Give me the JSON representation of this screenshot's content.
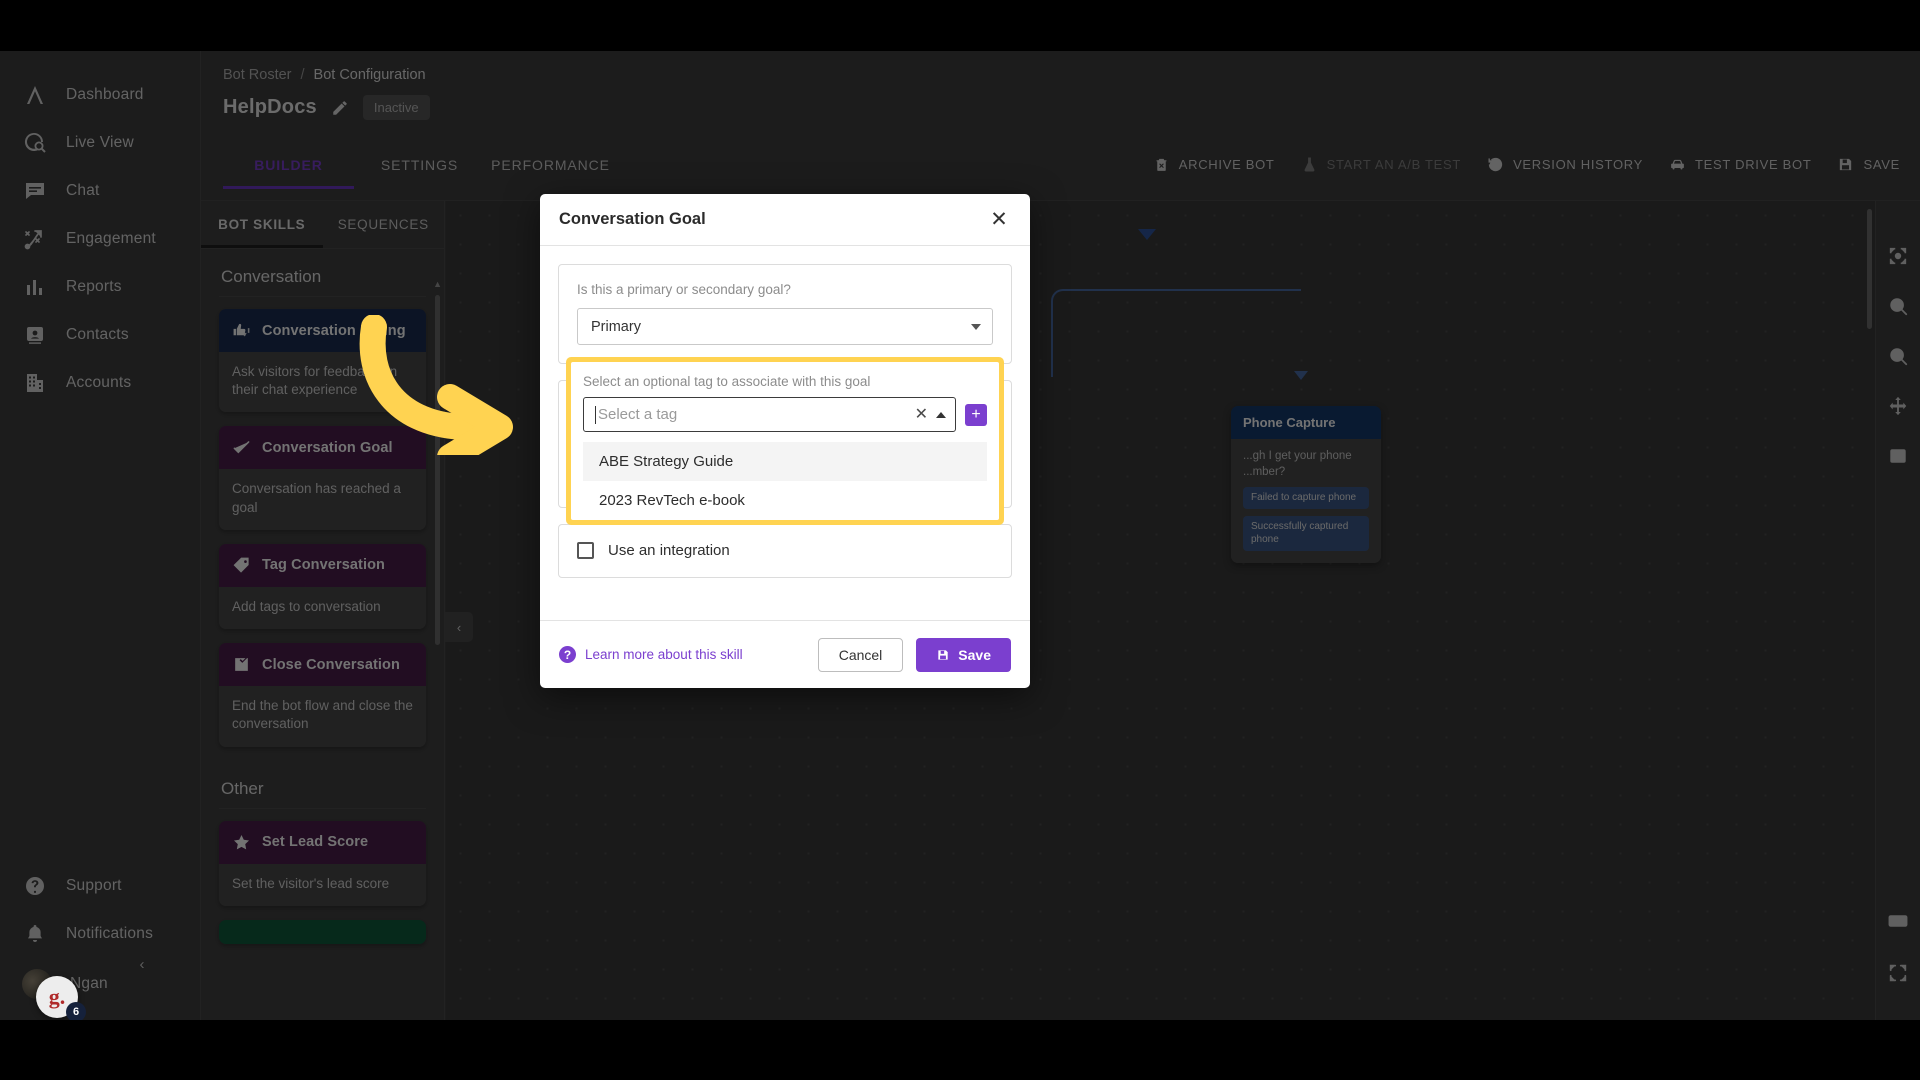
{
  "sidebar": {
    "items": [
      {
        "label": "Dashboard",
        "icon": "dashboard-icon"
      },
      {
        "label": "Live View",
        "icon": "live-view-icon"
      },
      {
        "label": "Chat",
        "icon": "chat-icon"
      },
      {
        "label": "Engagement",
        "icon": "engagement-icon"
      },
      {
        "label": "Reports",
        "icon": "reports-icon"
      },
      {
        "label": "Contacts",
        "icon": "contacts-icon"
      },
      {
        "label": "Accounts",
        "icon": "accounts-icon"
      }
    ],
    "bottom": [
      {
        "label": "Support",
        "icon": "help-circle-icon"
      },
      {
        "label": "Notifications",
        "icon": "bell-icon"
      }
    ],
    "user": {
      "name": "Ngan"
    },
    "collapse": "‹"
  },
  "chat_widget": {
    "letter": "g.",
    "badge": "6"
  },
  "header": {
    "breadcrumb": {
      "root": "Bot Roster",
      "separator": "/",
      "current": "Bot Configuration"
    },
    "bot_name": "HelpDocs",
    "status": "Inactive",
    "tabs": [
      {
        "label": "BUILDER",
        "active": true
      },
      {
        "label": "SETTINGS",
        "active": false
      },
      {
        "label": "PERFORMANCE",
        "active": false
      }
    ],
    "actions": [
      {
        "label": "ARCHIVE BOT",
        "icon": "trash-icon",
        "disabled": false
      },
      {
        "label": "START AN A/B TEST",
        "icon": "flask-icon",
        "disabled": true
      },
      {
        "label": "VERSION HISTORY",
        "icon": "history-icon",
        "disabled": false
      },
      {
        "label": "TEST DRIVE BOT",
        "icon": "car-icon",
        "disabled": false
      },
      {
        "label": "SAVE",
        "icon": "save-icon",
        "disabled": false
      }
    ]
  },
  "skills_panel": {
    "tabs": [
      {
        "label": "BOT SKILLS",
        "active": true
      },
      {
        "label": "SEQUENCES",
        "active": false
      }
    ],
    "groups": [
      {
        "title": "Conversation",
        "cards": [
          {
            "name": "Conversation Rating",
            "desc": "Ask visitors for feedback on their chat experience",
            "color": "navy",
            "icon": "thumbs-icon"
          },
          {
            "name": "Conversation Goal",
            "desc": "Conversation has reached a goal",
            "color": "plum",
            "icon": "check-flag-icon"
          },
          {
            "name": "Tag Conversation",
            "desc": "Add tags to conversation",
            "color": "plum",
            "icon": "tag-icon"
          },
          {
            "name": "Close Conversation",
            "desc": "End the bot flow and close the conversation",
            "color": "plum",
            "icon": "check-box-icon"
          }
        ]
      },
      {
        "title": "Other",
        "cards": [
          {
            "name": "Set Lead Score",
            "desc": "Set the visitor's lead score",
            "color": "plum",
            "icon": "star-icon"
          },
          {
            "name": "",
            "desc": "",
            "color": "green",
            "icon": ""
          }
        ]
      }
    ]
  },
  "canvas": {
    "node": {
      "title": "Phone Capture",
      "body": "...gh I get your phone ...mber?",
      "pills": [
        "Failed to capture phone",
        "Successfully captured phone"
      ]
    }
  },
  "right_rail": {
    "buttons": [
      {
        "icon": "fit-screen-icon"
      },
      {
        "icon": "zoom-in-icon"
      },
      {
        "icon": "zoom-out-icon"
      },
      {
        "icon": "move-icon"
      },
      {
        "icon": "frame-icon"
      },
      {
        "icon": "keyboard-icon"
      },
      {
        "icon": "fullscreen-icon"
      }
    ]
  },
  "modal": {
    "title": "Conversation Goal",
    "close_icon": "close-icon",
    "goal_type": {
      "label": "Is this a primary or secondary goal?",
      "value": "Primary"
    },
    "tag_field": {
      "label": "Select an optional tag to associate with this goal",
      "placeholder": "Select a tag",
      "value": "",
      "clear_icon": "clear-icon",
      "add_icon": "add-tag-icon",
      "options": [
        {
          "label": "ABE Strategy Guide",
          "highlighted": true
        },
        {
          "label": "2023 RevTech e-book",
          "highlighted": false
        }
      ]
    },
    "integration": {
      "label": "Use an integration",
      "checked": false
    },
    "footer": {
      "learn_more": "Learn more about this skill",
      "cancel": "Cancel",
      "save": "Save"
    }
  },
  "colors": {
    "accent_purple": "#7b3fcf",
    "highlight_yellow": "#ffd351",
    "navy": "#1c2e53",
    "plum": "#4d1e4d",
    "green": "#0f5c3d"
  }
}
